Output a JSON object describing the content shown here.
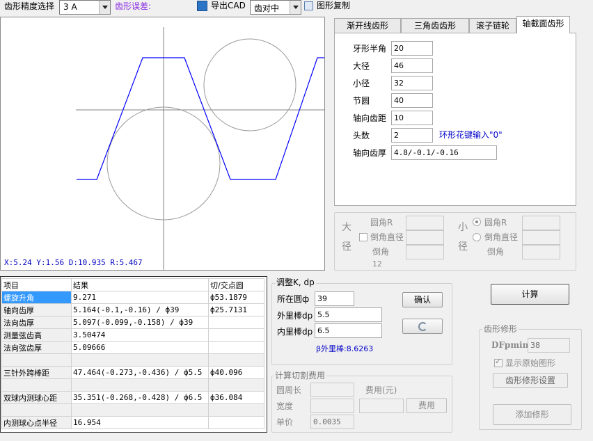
{
  "toolbar": {
    "precision_label": "齿形精度选择",
    "precision_value": "3  A",
    "error_label": "齿形误差:",
    "export_cad": "导出CAD",
    "align_value": "齿对中",
    "copy_shape": "图形复制"
  },
  "tabs": [
    "渐开线齿形",
    "三角齿齿形",
    "滚子链轮",
    "轴截面齿形"
  ],
  "params": {
    "half_angle_label": "牙形半角",
    "half_angle": "20",
    "major_label": "大径",
    "major": "46",
    "minor_label": "小径",
    "minor": "32",
    "pitch_label": "节圆",
    "pitch": "40",
    "axial_pitch_label": "轴向齿距",
    "axial_pitch": "10",
    "starts_label": "头数",
    "starts": "2",
    "starts_hint": "环形花键输入\"0\"",
    "axial_thick_label": "轴向齿厚",
    "axial_thick": "4.8/-0.1/-0.16"
  },
  "chamfer": {
    "major_side": "大径",
    "minor_side": "小径",
    "round_r": "圆角R",
    "chamfer_dia": "倒角直径",
    "chamfer": "倒角",
    "chamfer_value": "12"
  },
  "graph": {
    "status": "X:5.24  Y:1.56  D:10.935  R:5.467",
    "accent": "#0000ff"
  },
  "table": {
    "headers": [
      "项目",
      "结果",
      "切/交点圆"
    ],
    "rows": [
      {
        "item": "螺旋升角",
        "result": "9.271",
        "circle": "ф53.1879",
        "selected": true
      },
      {
        "item": "轴向齿厚",
        "result": "5.164(-0.1,-0.16) / ф39",
        "circle": "ф25.7131"
      },
      {
        "item": "法向齿厚",
        "result": "5.097(-0.099,-0.158) / ф39",
        "circle": ""
      },
      {
        "item": "测量弦齿高",
        "result": "3.50474",
        "circle": ""
      },
      {
        "item": "法向弦齿厚",
        "result": "5.09666",
        "circle": ""
      },
      {
        "item": "",
        "result": "",
        "circle": "",
        "blank": true
      },
      {
        "item": "三针外跨棒距",
        "result": "47.464(-0.273,-0.436) / ф5.5",
        "circle": "ф40.096"
      },
      {
        "item": "",
        "result": "",
        "circle": "",
        "blank": true
      },
      {
        "item": "双球内测球心距",
        "result": "35.351(-0.268,-0.428) / ф6.5",
        "circle": "ф36.084"
      },
      {
        "item": "",
        "result": "",
        "circle": "",
        "blank": true
      },
      {
        "item": "内测球心点半径",
        "result": "16.954",
        "circle": ""
      }
    ]
  },
  "adjust": {
    "title": "调整K, dp",
    "circle_label": "所在圆ф",
    "circle": "39",
    "outer_label": "外里棒dp",
    "outer": "5.5",
    "inner_label": "内里棒dp",
    "inner": "6.5",
    "confirm": "确认",
    "beta_text": "β外里棒:8.6263"
  },
  "cost": {
    "title": "计算切割费用",
    "perimeter": "圆周长",
    "width": "宽度",
    "unit_price": "单价",
    "unit_price_value": "0.0035",
    "fee_label": "费用(元)",
    "fee_button": "费用"
  },
  "calc": {
    "button": "计算"
  },
  "modify": {
    "title": "齿形修形",
    "dfpmin_label": "DFpmin",
    "dfpmin": "38",
    "show_original": "显示原始图形",
    "settings": "齿形修形设置",
    "add": "添加修形"
  }
}
